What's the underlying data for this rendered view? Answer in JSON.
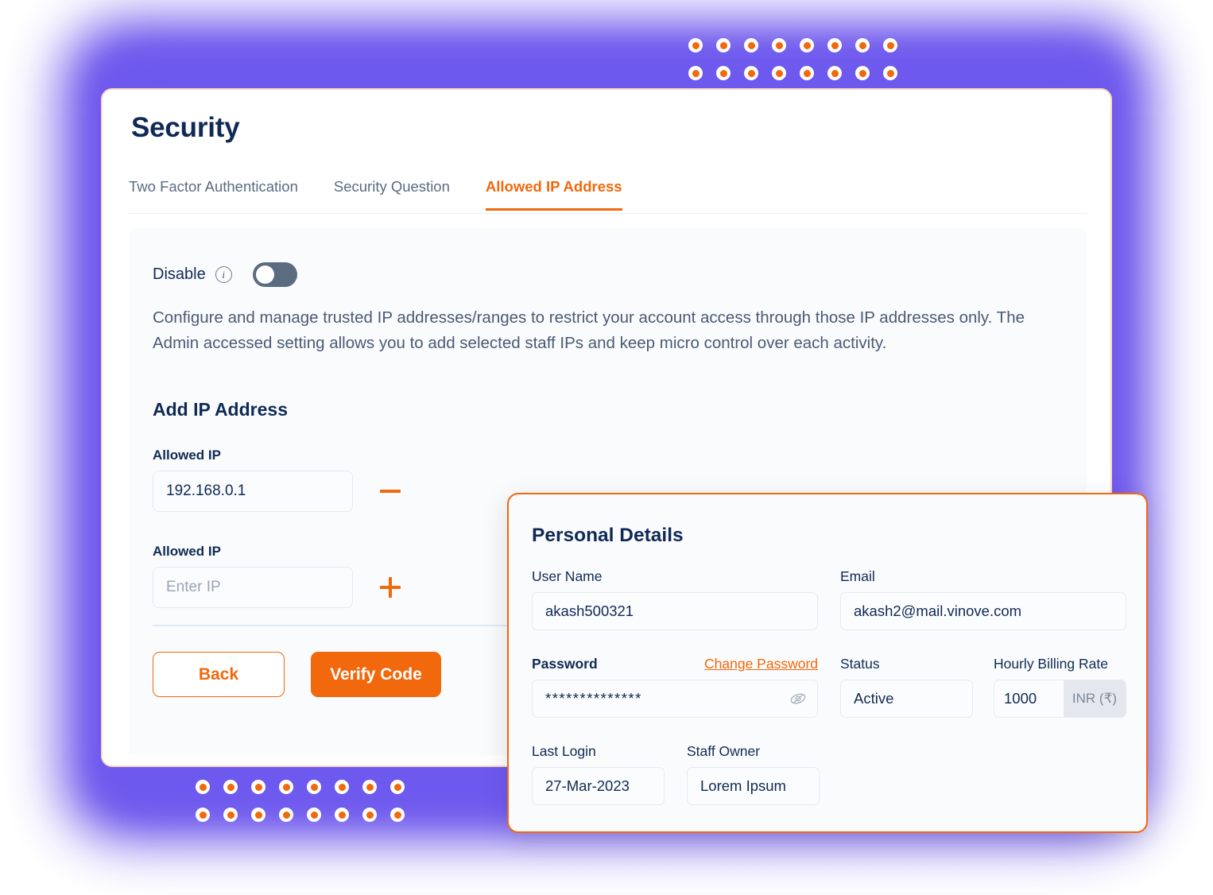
{
  "theme": {
    "accent_orange": "#f2680c",
    "navy": "#102a55",
    "glow_purple": "#5a3fe8",
    "panel_grey": "#fafbfc"
  },
  "security": {
    "title": "Security",
    "tabs": [
      {
        "label": "Two Factor Authentication",
        "active": false
      },
      {
        "label": "Security Question",
        "active": false
      },
      {
        "label": "Allowed IP Address",
        "active": true
      }
    ],
    "disable": {
      "label": "Disable",
      "info_icon": "info-icon",
      "toggle_state": "off"
    },
    "description": "Configure and manage trusted IP addresses/ranges to restrict your account access through those IP addresses only. The Admin accessed setting allows you to add selected staff IPs and keep micro control over each activity.",
    "add_ip_title": "Add IP Address",
    "ip_rows": [
      {
        "label": "Allowed IP",
        "value": "192.168.0.1",
        "placeholder": "",
        "action_icon": "minus-icon"
      },
      {
        "label": "Allowed IP",
        "value": "",
        "placeholder": "Enter IP",
        "action_icon": "plus-icon"
      }
    ],
    "buttons": {
      "back": "Back",
      "verify": "Verify Code"
    }
  },
  "personal_details": {
    "title": "Personal Details",
    "fields": {
      "user_name": {
        "label": "User Name",
        "value": "akash500321"
      },
      "email": {
        "label": "Email",
        "value": "akash2@mail.vinove.com"
      },
      "password": {
        "label": "Password",
        "value": "**************",
        "change_link": "Change Password",
        "toggle_icon": "eye-slash-icon"
      },
      "status": {
        "label": "Status",
        "value": "Active"
      },
      "hourly_rate": {
        "label": "Hourly Billing Rate",
        "value": "1000",
        "currency": "INR (₹)"
      },
      "last_login": {
        "label": "Last Login",
        "value": "27-Mar-2023"
      },
      "staff_owner": {
        "label": "Staff Owner",
        "value": "Lorem Ipsum"
      }
    }
  },
  "decor": {
    "dots_top": {
      "rows": 2,
      "cols": 8
    },
    "dots_bottom": {
      "rows": 2,
      "cols": 8
    }
  }
}
